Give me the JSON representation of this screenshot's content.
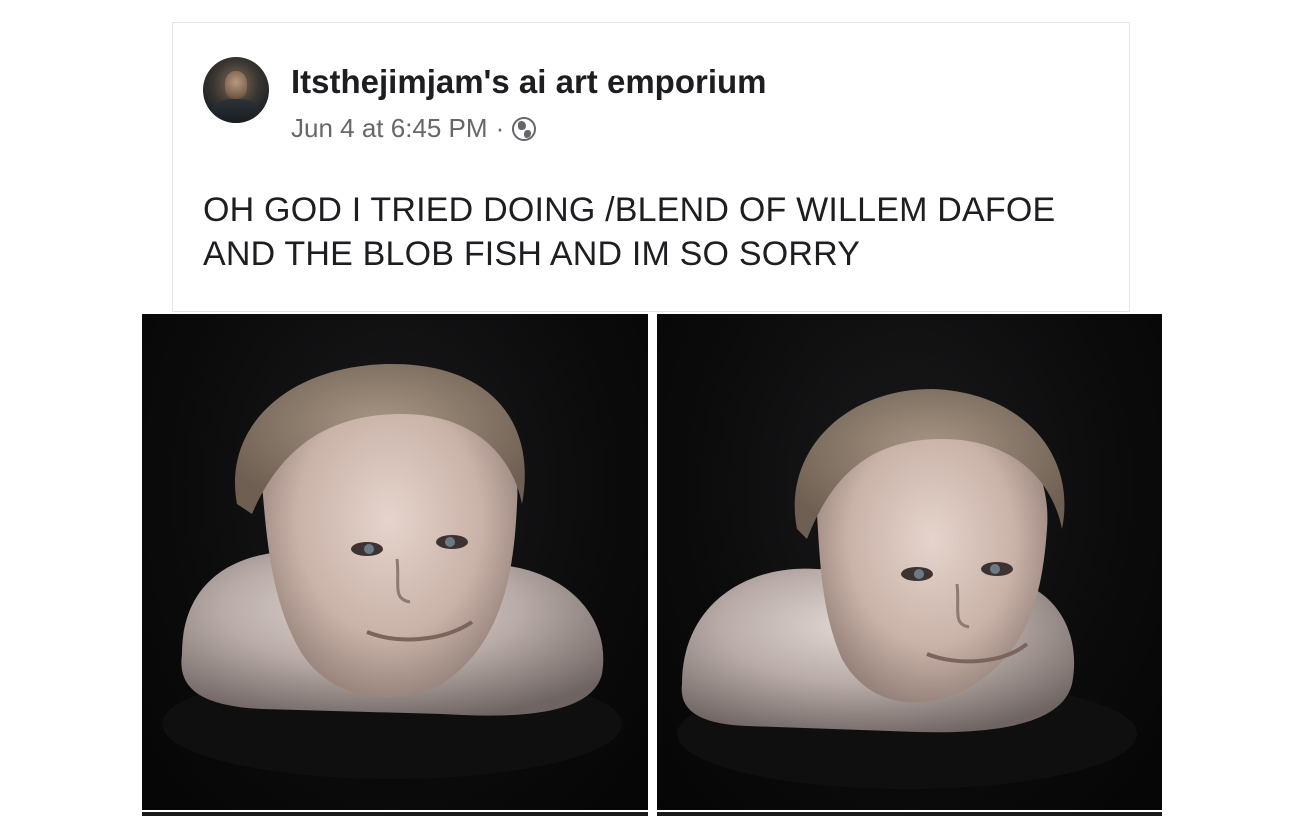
{
  "post": {
    "page_name": "Itsthejimjam's ai art emporium",
    "timestamp": "Jun 4 at 6:45 PM",
    "separator": "·",
    "privacy_icon": "globe-icon",
    "text": "OH GOD I TRIED DOING /BLEND OF WILLEM DAFOE AND THE BLOB FISH AND IM SO SORRY"
  },
  "photos": [
    {
      "name": "photo-left"
    },
    {
      "name": "photo-right"
    }
  ],
  "colors": {
    "name_text": "#1c1e21",
    "meta_text": "#65676b",
    "card_border": "#e3e5e9",
    "photo_bg": "#0b0b0c"
  }
}
